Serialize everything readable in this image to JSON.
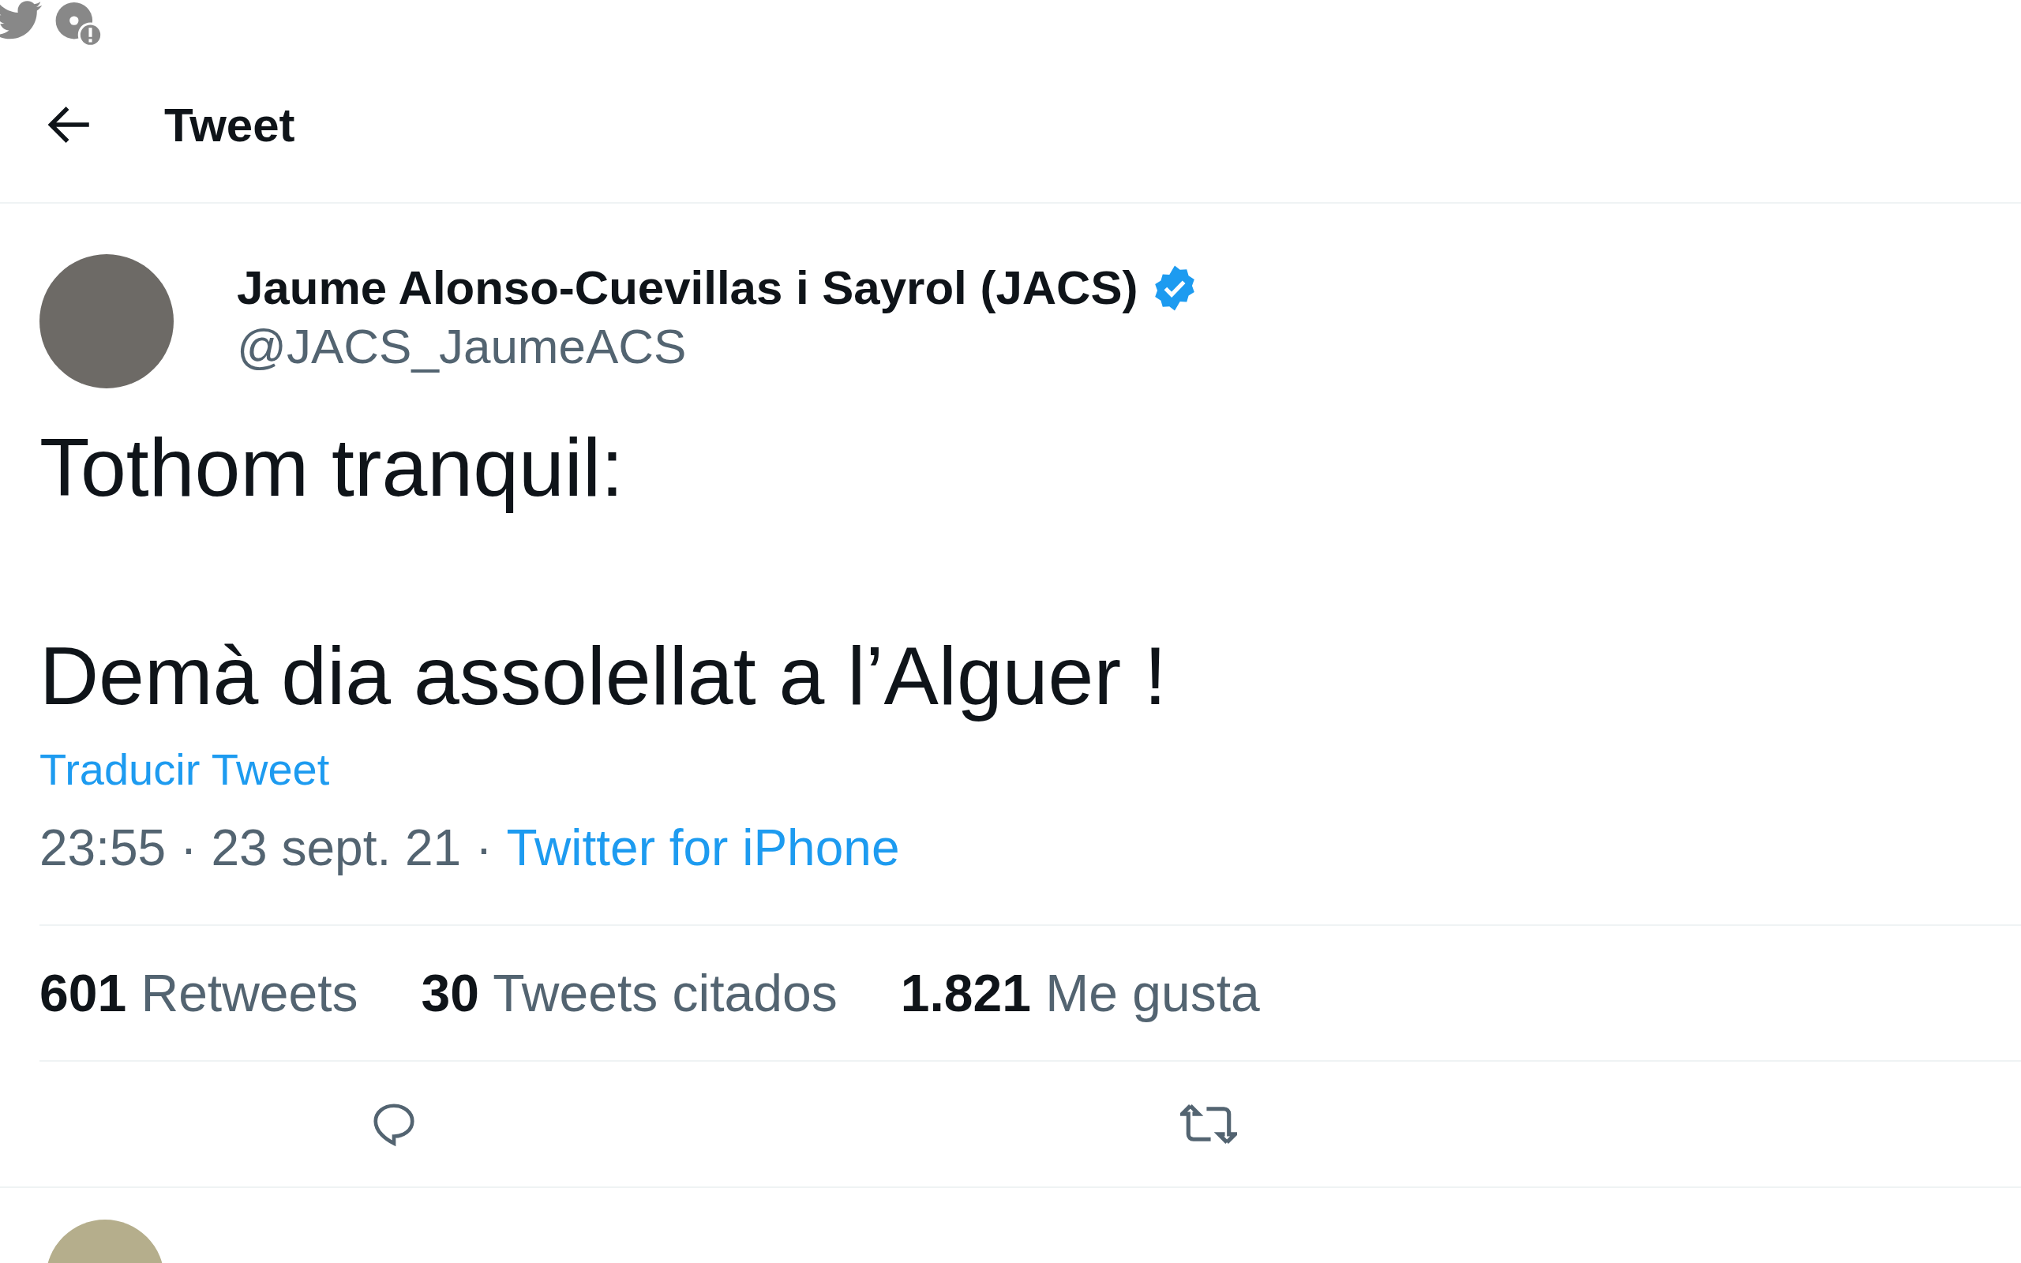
{
  "header": {
    "title": "Tweet"
  },
  "tweet": {
    "author": {
      "name": "Jaume Alonso-Cuevillas i Sayrol (JACS)",
      "verified": true,
      "handle": "@JACS_JaumeACS"
    },
    "paragraphs": [
      "Tothom tranquil:",
      "Demà dia assolellat a l’Alguer !"
    ],
    "separator": "·",
    "translate": "Traducir Tweet",
    "time": "23:55",
    "date": "23 sept. 21",
    "source": "Twitter for iPhone",
    "stats": [
      {
        "count": "601",
        "label": "Retweets"
      },
      {
        "count": "30",
        "label": "Tweets citados"
      },
      {
        "count": "1.821",
        "label": "Me gusta"
      }
    ]
  }
}
